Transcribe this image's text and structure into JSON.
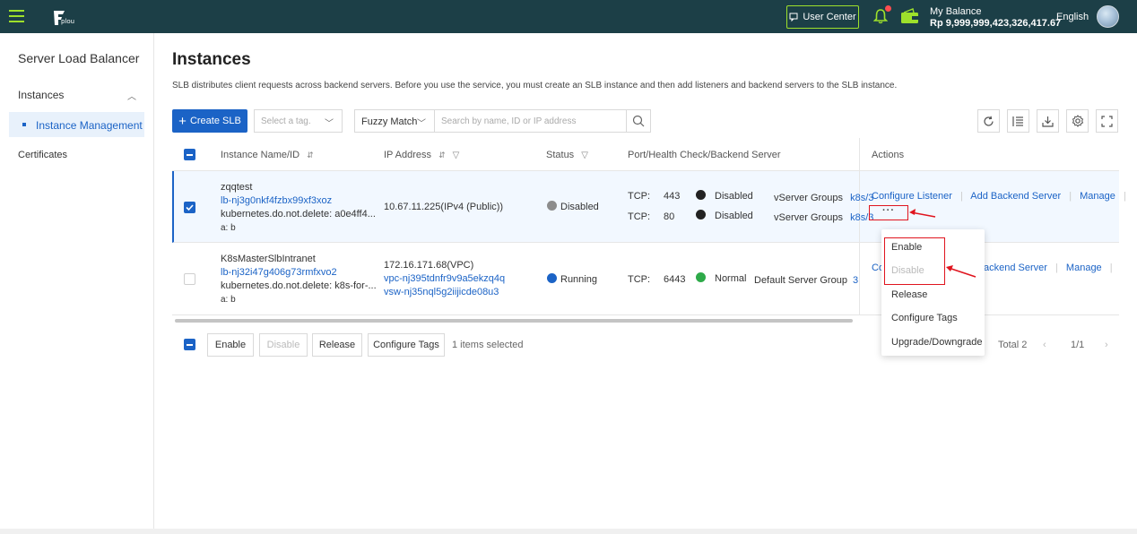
{
  "topbar": {
    "logo_text": "plou",
    "user_center": "User Center",
    "balance_label": "My Balance",
    "balance_value": "Rp 9,999,999,423,326,417.67",
    "language": "English",
    "colors": {
      "bg": "#1c3f47",
      "accent": "#9ee12b"
    }
  },
  "sidebar": {
    "title": "Server Load Balancer",
    "group": "Instances",
    "active_item": "Instance Management",
    "item2": "Certificates"
  },
  "page": {
    "title": "Instances",
    "description": "SLB distributes client requests across backend servers. Before you use the service, you must create an SLB instance and then add listeners and backend servers to the SLB instance."
  },
  "toolbar": {
    "create_label": "Create SLB",
    "tag_placeholder": "Select a tag.",
    "match_mode": "Fuzzy Match",
    "search_placeholder": "Search by name, ID or IP address"
  },
  "table": {
    "headers": {
      "name": "Instance Name/ID",
      "ip": "IP Address",
      "status": "Status",
      "port": "Port/Health Check/Backend Server",
      "actions": "Actions"
    },
    "rows": [
      {
        "name": "zqqtest",
        "id": "lb-nj3g0nkf4fzbx99xf3xoz",
        "tag1": "kubernetes.do.not.delete: a0e4ff4...",
        "tag2": "a: b",
        "ip": "10.67.11.225(IPv4 (Public))",
        "status": "Disabled",
        "listeners": [
          {
            "proto": "TCP:",
            "port": "443",
            "health": "Disabled",
            "group_label": "vServer Groups",
            "group_link": "k8s/3"
          },
          {
            "proto": "TCP:",
            "port": "80",
            "health": "Disabled",
            "group_label": "vServer Groups",
            "group_link": "k8s/3"
          }
        ],
        "actions": {
          "a1": "Configure Listener",
          "a2": "Add Backend Server",
          "a3": "Manage",
          "more": "···"
        }
      },
      {
        "name": "K8sMasterSlbIntranet",
        "id": "lb-nj32i47g406g73rmfxvo2",
        "tag1": "kubernetes.do.not.delete: k8s-for-...",
        "tag2": "a: b",
        "ip": "172.16.171.68(VPC)",
        "vpc": "vpc-nj395tdnfr9v9a5ekzq4q",
        "vsw": "vsw-nj35nql5g2iijicde08u3",
        "status": "Running",
        "listeners": [
          {
            "proto": "TCP:",
            "port": "6443",
            "health": "Normal",
            "group_label": "Default Server Group",
            "group_link": "3"
          }
        ],
        "actions": {
          "a1": "Co",
          "a2": "ackend Server",
          "a3": "Manage"
        }
      }
    ]
  },
  "footer": {
    "enable": "Enable",
    "disable": "Disable",
    "release": "Release",
    "configure_tags": "Configure Tags",
    "selected": "1 items selected",
    "total": "Total 2",
    "pages": "1/1"
  },
  "dropdown": {
    "items": [
      "Enable",
      "Disable",
      "Release",
      "Configure Tags",
      "Upgrade/Downgrade"
    ]
  }
}
